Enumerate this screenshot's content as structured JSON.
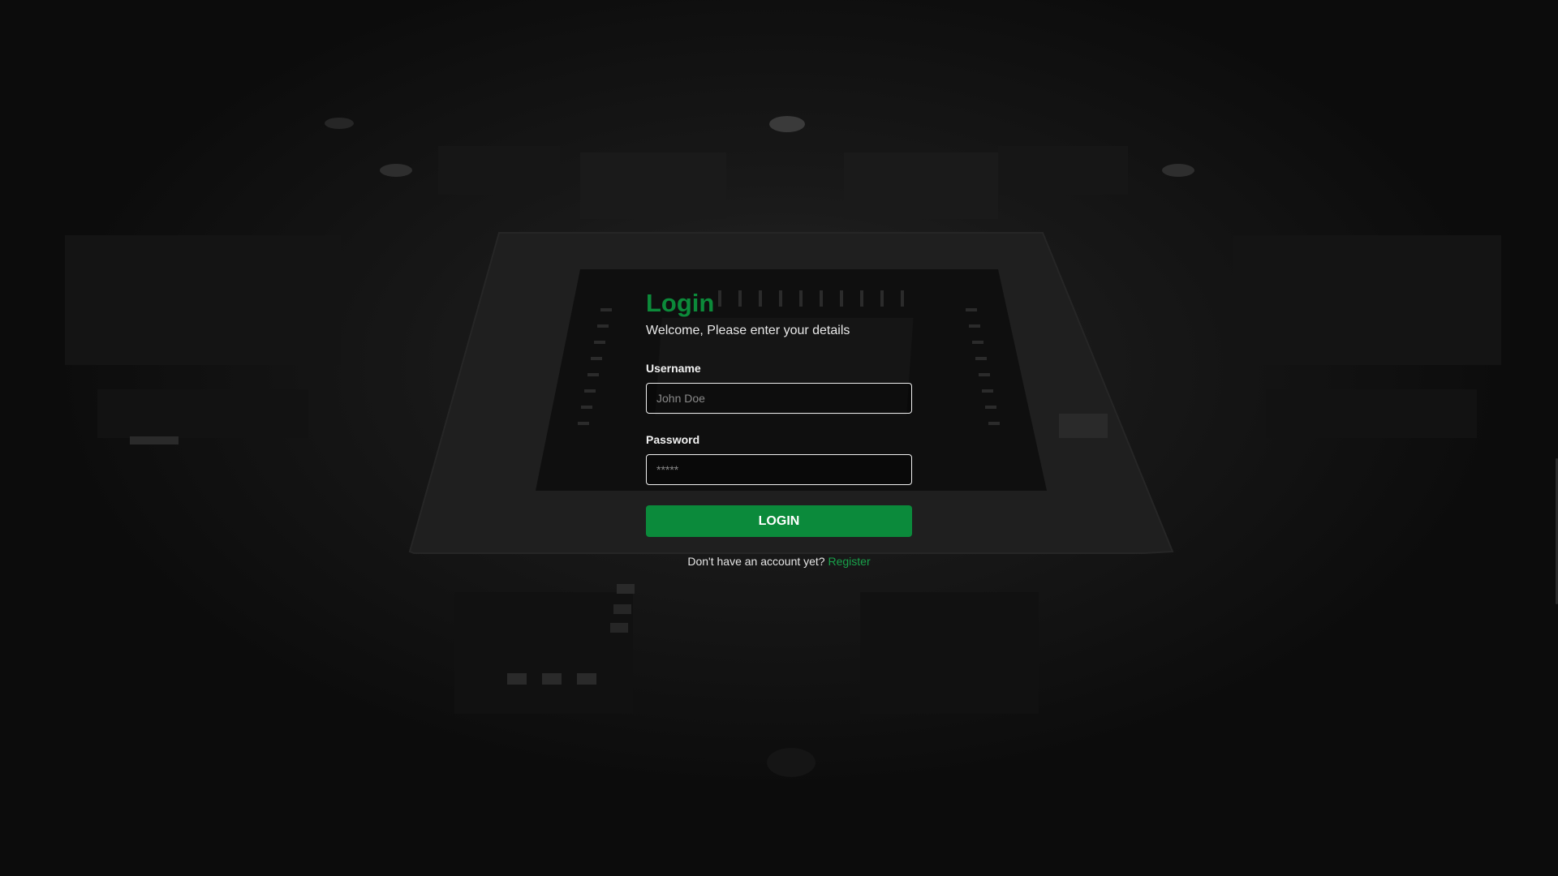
{
  "background": {
    "description_icon": "circuit-board-background",
    "base_color": "#0d0d0d"
  },
  "login": {
    "title": "Login",
    "subtitle": "Welcome, Please enter your details",
    "username_label": "Username",
    "username_placeholder": "John Doe",
    "username_value": "",
    "password_label": "Password",
    "password_placeholder": "*****",
    "password_value": "",
    "button_label": "LOGIN",
    "register_prompt": "Don't have an account yet?",
    "register_link": "Register"
  },
  "colors": {
    "accent": "#0b8a3b",
    "link": "#18a14a",
    "title": "#0c8a3a"
  }
}
